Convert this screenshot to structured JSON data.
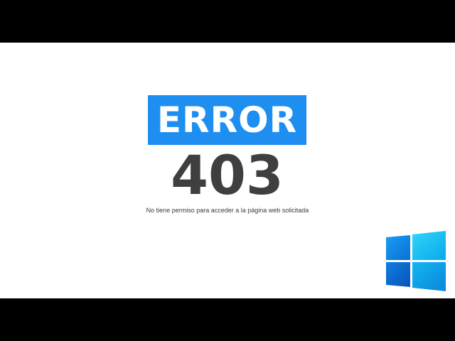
{
  "error": {
    "badge_text": "ERROR",
    "code": "403",
    "message": "No tiene permiso  para acceder a la página  web solicitada"
  },
  "logo": {
    "icon": "windows-logo-icon",
    "colors": {
      "top_left": "#0f7fe0",
      "top_right": "#13c3f3",
      "bottom_left": "#0a64cc",
      "bottom_right": "#0fa8ee"
    }
  },
  "colors": {
    "badge_bg": "#1e8ff0",
    "code_text": "#3f3f3f",
    "letterbox": "#000000",
    "content_bg": "#ffffff"
  }
}
